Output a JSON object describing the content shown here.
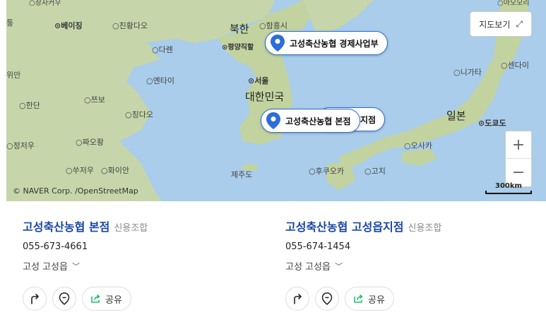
{
  "map": {
    "labels": {
      "jangjakou": "장자커우",
      "aomori": "아오모리",
      "tong": "퉁",
      "beijing": "베이징",
      "chinhwangdao": "친황다오",
      "north_korea": "북한",
      "hamheung": "함흥시",
      "pyongyang": "평양직할",
      "dalian": "다롄",
      "niigata": "니가타",
      "sendai": "센다이",
      "wian": "위안",
      "yantai": "옌타이",
      "seoul": "서울",
      "south_korea": "대한민국",
      "handan": "한단",
      "jibo": "쯔보",
      "qingdao": "칭다오",
      "japan": "일본",
      "tokyo": "도쿄도",
      "jeongjeou": "정저우",
      "lianyungang": "짜오좡",
      "osaka": "오사카",
      "suzhou": "쑤저우",
      "huaian": "화이안",
      "jeju": "제주도",
      "fukuoka": "후쿠오카",
      "kochi": "고치"
    },
    "pins": [
      {
        "label": "고성축산농협 경제사업부"
      },
      {
        "label": "고성축산농협 본점"
      },
      {
        "label": "지점"
      }
    ],
    "toggle_label": "지도보기",
    "zoom_in": "+",
    "zoom_out": "−",
    "attribution": "© NAVER Corp. /OpenStreetMap",
    "scale": "300km"
  },
  "cards": [
    {
      "name": "고성축산농협 본점",
      "category": "신용조합",
      "phone": "055-673-4661",
      "address": "고성 고성읍",
      "share_label": "공유"
    },
    {
      "name": "고성축산농협 고성읍지점",
      "category": "신용조합",
      "phone": "055-674-1454",
      "address": "고성 고성읍",
      "share_label": "공유"
    }
  ],
  "colors": {
    "sea": "#a9cdea",
    "land": "#c9d8ae",
    "pin_blue": "#2e6dd8",
    "name_blue": "#1b46a8",
    "share_green": "#1ec26a"
  }
}
